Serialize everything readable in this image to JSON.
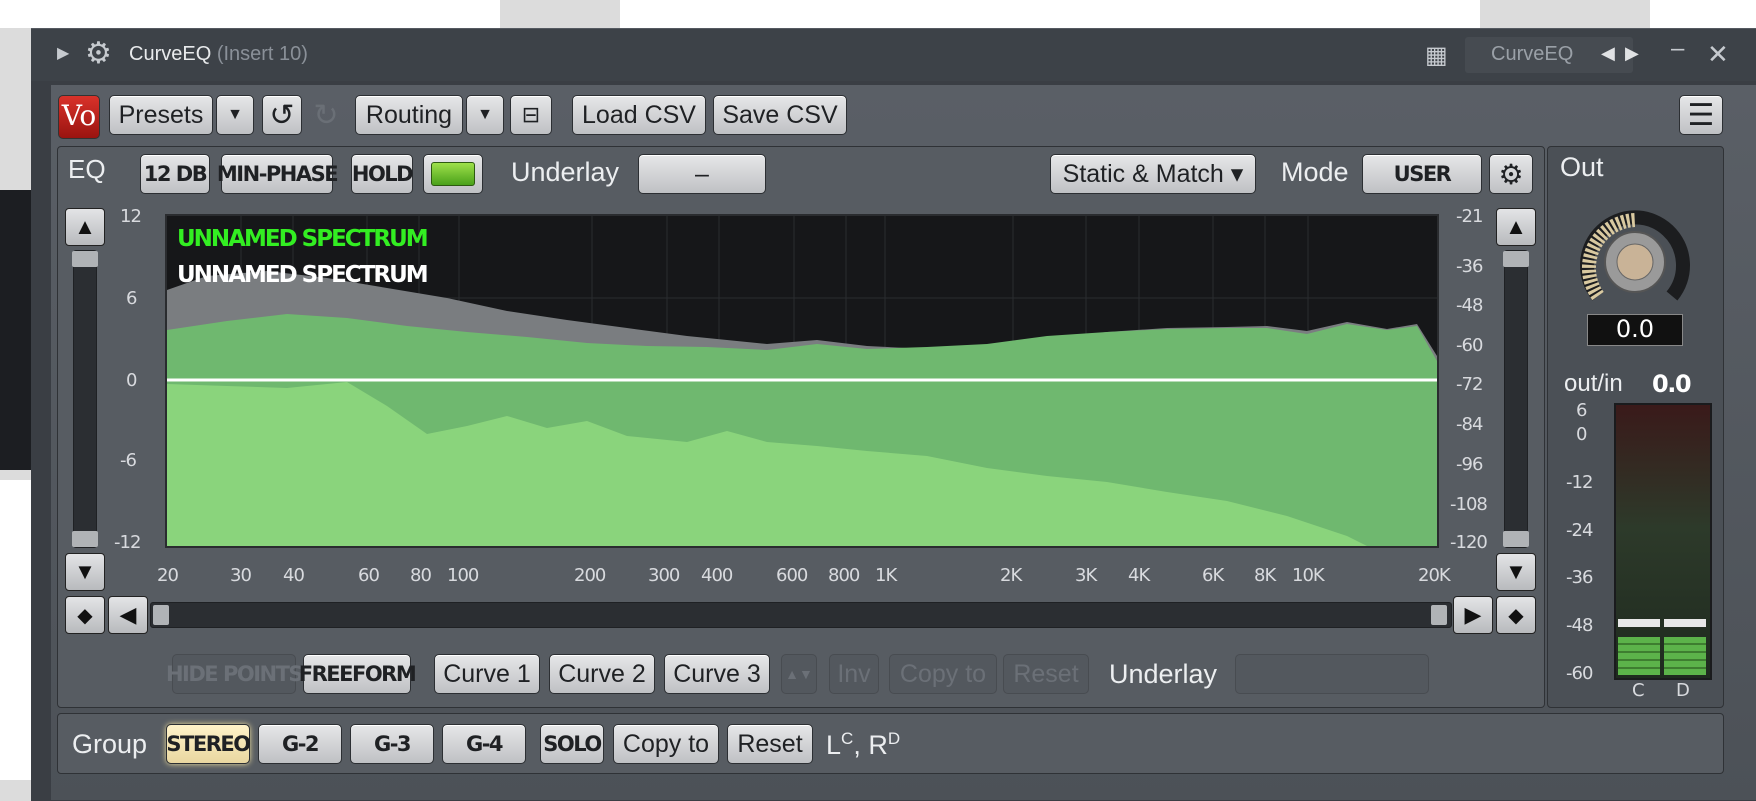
{
  "window": {
    "title": "CurveEQ",
    "subtitle": "(Insert 10)",
    "right_title": "CurveEQ",
    "icons": [
      "expand-arrow-icon",
      "gear-icon",
      "grid-icon",
      "prev-arrow-icon",
      "next-arrow-icon",
      "minimize-icon",
      "close-icon"
    ]
  },
  "toolbar": {
    "presets": "Presets",
    "routing": "Routing",
    "load_csv": "Load CSV",
    "save_csv": "Save CSV"
  },
  "eq": {
    "tab": "EQ",
    "db12": "12 DB",
    "min_phase": "MIN-PHASE",
    "hold": "HOLD",
    "underlay_label": "Underlay",
    "underlay_value": "–",
    "static_match": "Static & Match ▾",
    "mode_label": "Mode",
    "mode_value": "USER"
  },
  "plot": {
    "spectrum_green": "UNNAMED SPECTRUM",
    "spectrum_white": "UNNAMED SPECTRUM",
    "left_axis": [
      "12",
      "6",
      "0",
      "-6",
      "-12"
    ],
    "right_axis": [
      "-21",
      "-36",
      "-48",
      "-60",
      "-72",
      "-84",
      "-96",
      "-108",
      "-120"
    ],
    "freq_axis": [
      "20",
      "30",
      "40",
      "60",
      "80",
      "100",
      "200",
      "300",
      "400",
      "600",
      "800",
      "1K",
      "2K",
      "3K",
      "4K",
      "6K",
      "8K",
      "10K",
      "20K"
    ],
    "colors": {
      "green_spectrum": "#6fc36f",
      "gray_spectrum": "#7a7d80",
      "zero_line": "#ffffff",
      "label_green": "#33ee22"
    }
  },
  "curves": {
    "hide_points": "HIDE POINTS",
    "freeform": "FREEFORM",
    "curve1": "Curve 1",
    "curve2": "Curve 2",
    "curve3": "Curve 3",
    "inv": "Inv",
    "copy_to": "Copy to",
    "reset": "Reset",
    "underlay": "Underlay"
  },
  "group": {
    "label": "Group",
    "stereo": "STEREO",
    "g2": "G-2",
    "g3": "G-3",
    "g4": "G-4",
    "solo": "SOLO",
    "copy_to": "Copy to",
    "reset": "Reset",
    "channels_l": "L",
    "channels_l_sup": "C",
    "channels_sep": ", R",
    "channels_r_sup": "D"
  },
  "out": {
    "tab": "Out",
    "knob_value": "0.0",
    "outin_label": "out/in",
    "outin_value": "0.0",
    "meter_scale": [
      "6",
      "0",
      "-12",
      "-24",
      "-36",
      "-48",
      "-60"
    ],
    "meter_channels": [
      "C",
      "D"
    ]
  }
}
